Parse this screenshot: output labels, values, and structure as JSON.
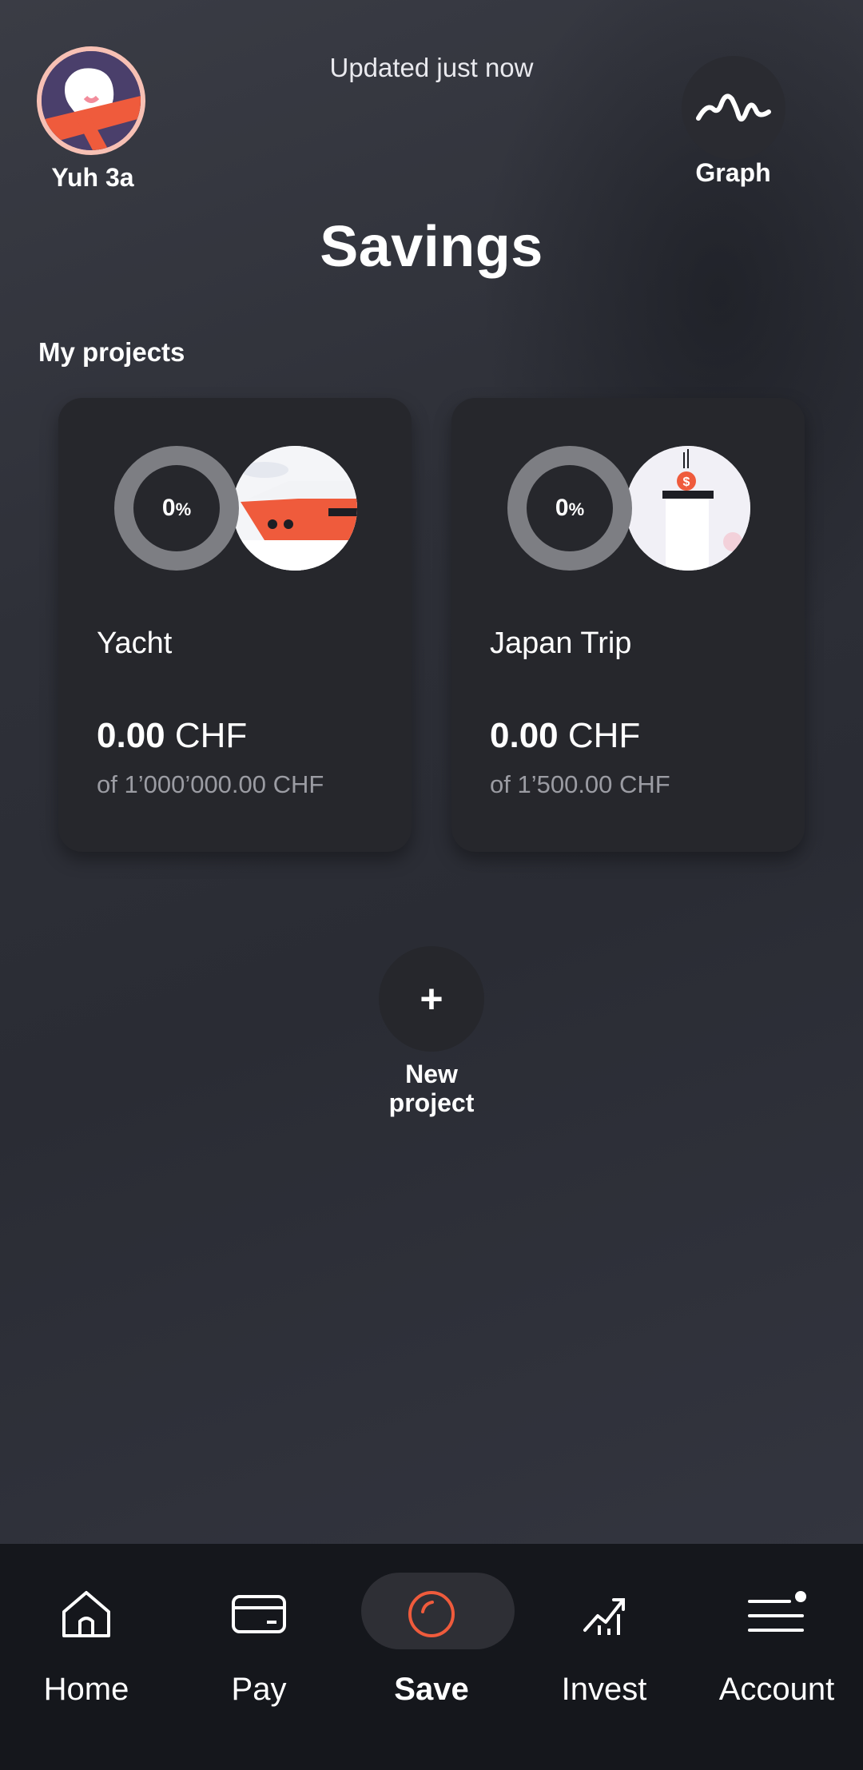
{
  "header": {
    "profile_name": "Yuh 3a",
    "updated_text": "Updated just now",
    "graph_label": "Graph",
    "title": "Savings"
  },
  "section_label": "My projects",
  "projects": [
    {
      "name": "Yacht",
      "progress_text": "0",
      "progress_unit": "%",
      "amount": "0.00",
      "currency": "CHF",
      "target": "of 1’000’000.00 CHF"
    },
    {
      "name": "Japan Trip",
      "progress_text": "0",
      "progress_unit": "%",
      "amount": "0.00",
      "currency": "CHF",
      "target": "of 1’500.00 CHF"
    }
  ],
  "new_project": {
    "icon": "+",
    "label": "New project"
  },
  "nav": {
    "items": [
      {
        "label": "Home",
        "icon": "home-icon"
      },
      {
        "label": "Pay",
        "icon": "card-icon"
      },
      {
        "label": "Save",
        "icon": "save-icon"
      },
      {
        "label": "Invest",
        "icon": "invest-icon"
      },
      {
        "label": "Account",
        "icon": "menu-icon"
      }
    ],
    "active": "Save"
  },
  "colors": {
    "accent": "#ef5b3c",
    "card_bg": "#26272c",
    "ring": "#7d7e83",
    "avatar_border": "#f7c0b4"
  }
}
